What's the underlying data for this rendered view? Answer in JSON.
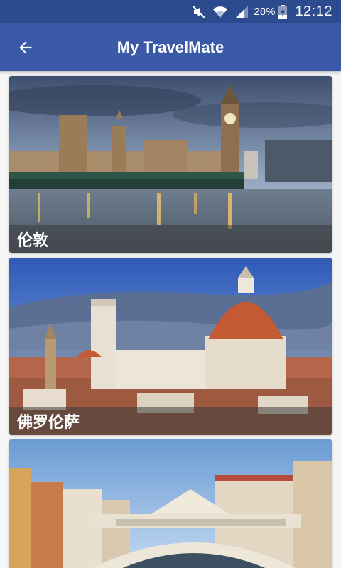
{
  "status_bar": {
    "battery_percent": "28%",
    "time": "12:12",
    "icons": [
      "mute-icon",
      "wifi-icon",
      "signal-icon",
      "battery-charging-icon"
    ]
  },
  "app_bar": {
    "title": "My TravelMate",
    "back_icon": "arrow-left-icon"
  },
  "destinations": [
    {
      "name": "伦敦"
    },
    {
      "name": "佛罗伦萨"
    },
    {
      "name": ""
    }
  ],
  "colors": {
    "status_bar": "#2c4a8e",
    "app_bar": "#3a5aa7",
    "background": "#f5f5f5"
  }
}
